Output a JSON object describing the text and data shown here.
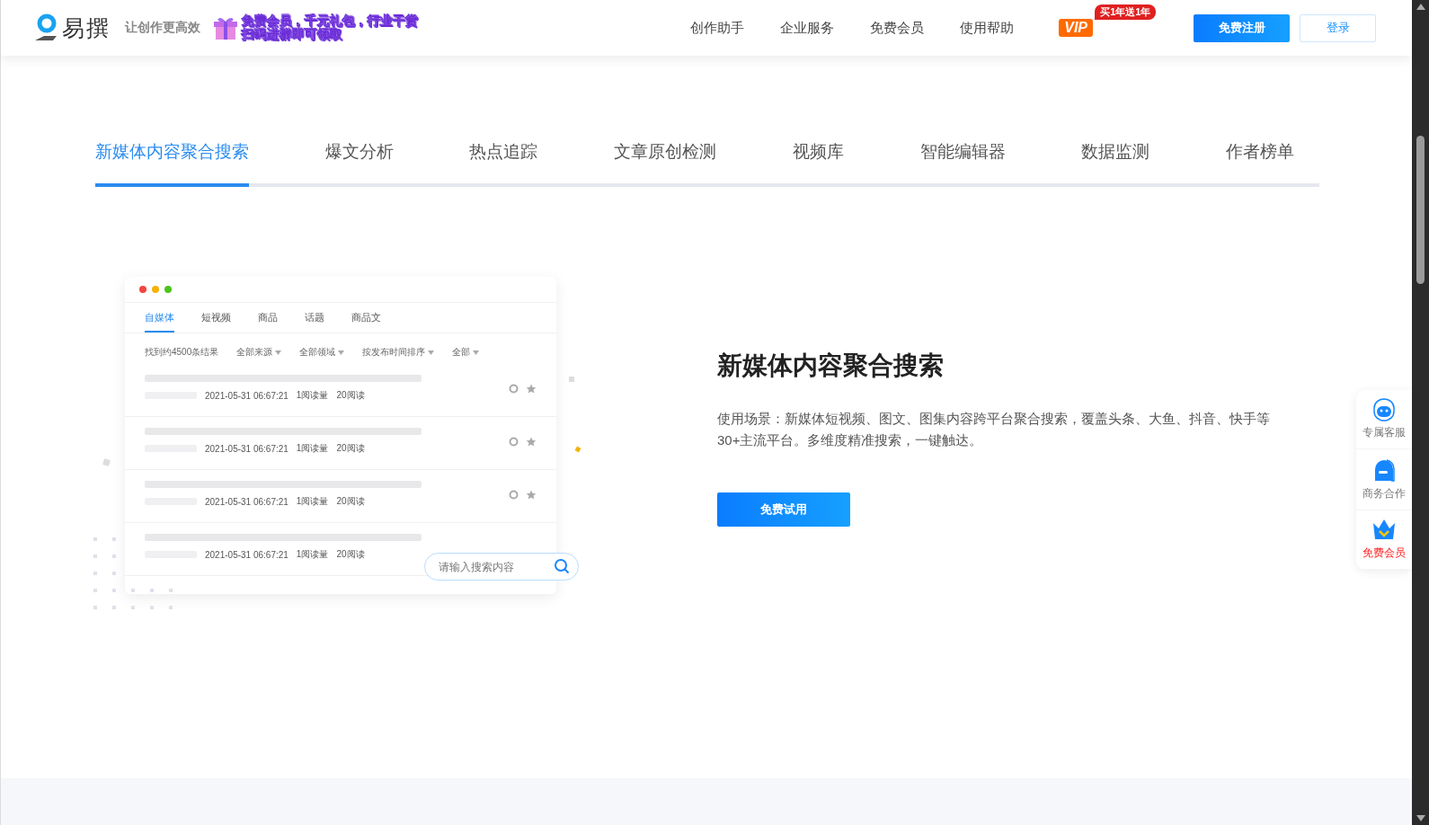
{
  "header": {
    "logo_text": "易撰",
    "slogan": "让创作更高效",
    "promo_lines": [
      "免费会员，千元礼包，行业干货",
      "扫码进群即可领取"
    ],
    "nav": [
      "创作助手",
      "企业服务",
      "免费会员",
      "使用帮助"
    ],
    "vip_label": "VIP",
    "vip_badge": "买1年送1年",
    "register": "免费注册",
    "login": "登录"
  },
  "feature_tabs": [
    {
      "label": "新媒体内容聚合搜索",
      "selected": true
    },
    {
      "label": "爆文分析",
      "selected": false
    },
    {
      "label": "热点追踪",
      "selected": false
    },
    {
      "label": "文章原创检测",
      "selected": false
    },
    {
      "label": "视频库",
      "selected": false
    },
    {
      "label": "智能编辑器",
      "selected": false
    },
    {
      "label": "数据监测",
      "selected": false
    },
    {
      "label": "作者榜单",
      "selected": false
    }
  ],
  "mockup": {
    "tabs": [
      {
        "label": "自媒体",
        "selected": true
      },
      {
        "label": "短视频",
        "selected": false
      },
      {
        "label": "商品",
        "selected": false
      },
      {
        "label": "话题",
        "selected": false
      },
      {
        "label": "商品文",
        "selected": false
      }
    ],
    "result_count": "找到约4500条结果",
    "filters": [
      "全部来源",
      "全部领域",
      "按发布时间排序",
      "全部"
    ],
    "rows": [
      {
        "date": "2021-05-31 06:67:21",
        "reads": "1阅读量",
        "reads2": "20阅读",
        "actions": true
      },
      {
        "date": "2021-05-31 06:67:21",
        "reads": "1阅读量",
        "reads2": "20阅读",
        "actions": true
      },
      {
        "date": "2021-05-31 06:67:21",
        "reads": "1阅读量",
        "reads2": "20阅读",
        "actions": true
      },
      {
        "date": "2021-05-31 06:67:21",
        "reads": "1阅读量",
        "reads2": "20阅读",
        "actions": false
      }
    ],
    "search_placeholder": "请输入搜索内容"
  },
  "feature": {
    "title": "新媒体内容聚合搜索",
    "description": "使用场景：新媒体短视频、图文、图集内容跨平台聚合搜索，覆盖头条、大鱼、抖音、快手等30+主流平台。多维度精准搜索，一键触达。",
    "button": "免费试用"
  },
  "side_panel": [
    {
      "kind": "service",
      "label": "专属客服"
    },
    {
      "kind": "business",
      "label": "商务合作"
    },
    {
      "kind": "vip",
      "label": "免费会员"
    }
  ]
}
